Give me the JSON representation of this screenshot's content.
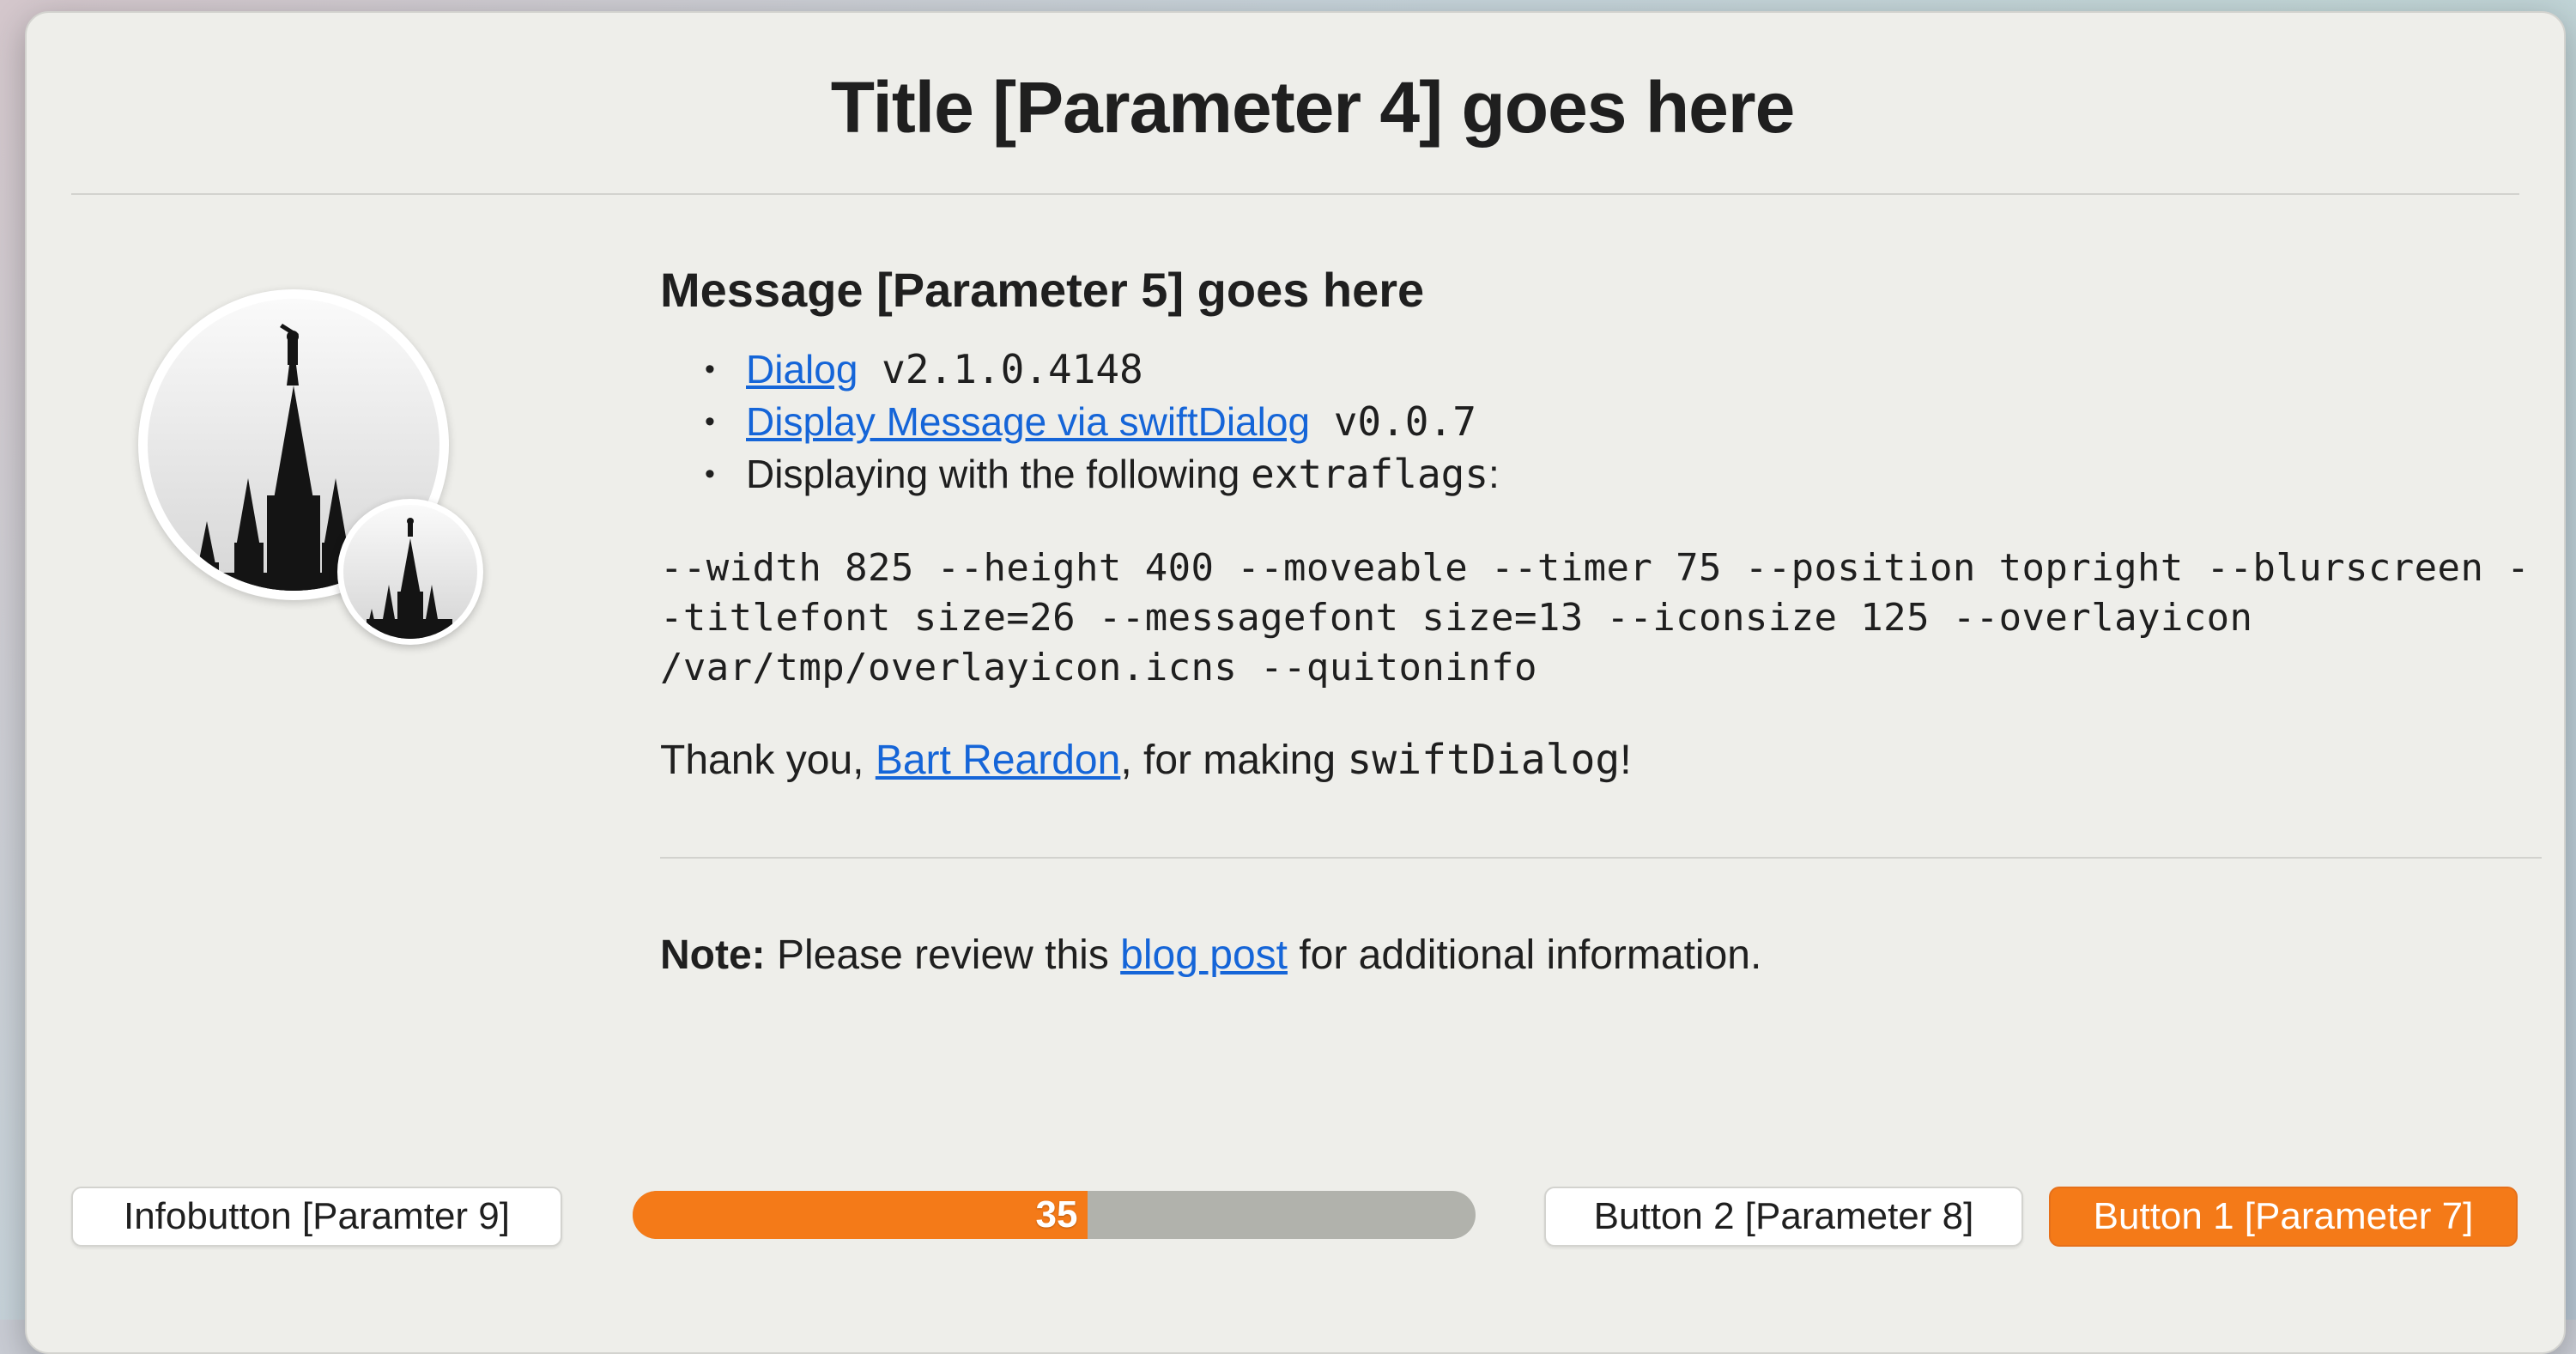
{
  "dialog": {
    "title": "Title [Parameter 4] goes here"
  },
  "message": {
    "heading": "Message [Parameter 5] goes here",
    "items": [
      {
        "link": "Dialog",
        "text": " v2.1.0.4148"
      },
      {
        "link": "Display Message via swiftDialog",
        "text": " v0.0.7"
      },
      {
        "prefix": "Displaying with the following ",
        "code": "extraflags",
        "suffix": ":"
      }
    ],
    "flags": "--width 825 --height 400 --moveable --timer 75 --position topright --blurscreen --titlefont size=26 --messagefont size=13 --iconsize 125 --overlayicon /var/tmp/overlayicon.icns --quitoninfo",
    "thanks": {
      "prefix": "Thank you, ",
      "link": "Bart Reardon",
      "middle": ", for making ",
      "code": "swiftDialog",
      "suffix": "!"
    }
  },
  "note": {
    "label": "Note:",
    "prefix": " Please review this ",
    "link": "blog post",
    "suffix": " for additional information."
  },
  "footer": {
    "info_button": "Infobutton [Paramter 9]",
    "button2": "Button 2 [Parameter 8]",
    "button1": "Button 1 [Parameter 7]",
    "timer_value": "35",
    "timer_progress": 0.54
  },
  "colors": {
    "accent": "#f47a18",
    "link": "#1565d8",
    "window_bg": "#eeeeea"
  },
  "icons": {
    "main": "temple-silhouette-icon",
    "overlay": "temple-silhouette-overlay-icon"
  }
}
